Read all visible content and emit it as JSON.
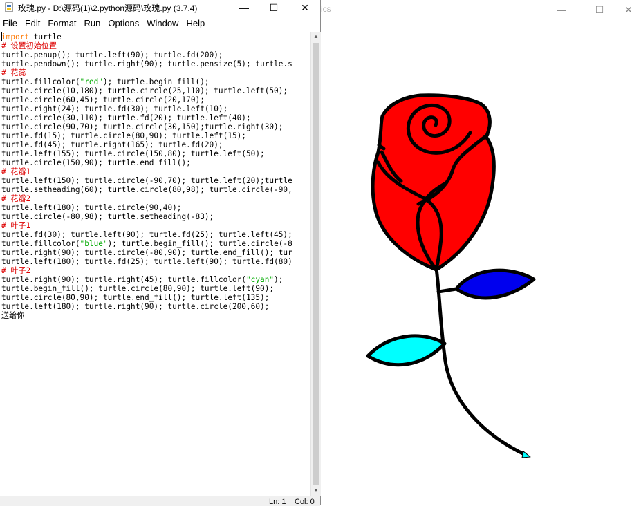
{
  "turtle_window": {
    "title": "ics",
    "controls": {
      "minimize": "—",
      "maximize": "☐",
      "close": "✕"
    },
    "colors": {
      "petal": "#ff0000",
      "leaf_upper": "#0000ee",
      "leaf_lower": "#00ffff",
      "stroke": "#000000",
      "turtle_cursor": "#00ffff"
    }
  },
  "editor": {
    "title": "玫瑰.py - D:\\源码(1)\\2.python源码\\玫瑰.py (3.7.4)",
    "controls": {
      "minimize": "—",
      "maximize": "☐",
      "close": "✕"
    },
    "menu": [
      "File",
      "Edit",
      "Format",
      "Run",
      "Options",
      "Window",
      "Help"
    ],
    "code_lines": [
      [
        {
          "t": "import",
          "c": "kw"
        },
        {
          "t": " turtle",
          "c": ""
        }
      ],
      [
        {
          "t": "# 设置初始位置",
          "c": "cm"
        }
      ],
      [
        {
          "t": "turtle.penup(); turtle.left(90); turtle.fd(200);",
          "c": ""
        }
      ],
      [
        {
          "t": "turtle.pendown(); turtle.right(90); turtle.pensize(5); turtle.s",
          "c": ""
        }
      ],
      [
        {
          "t": "# 花蕊",
          "c": "cm"
        }
      ],
      [
        {
          "t": "turtle.fillcolor(",
          "c": ""
        },
        {
          "t": "\"red\"",
          "c": "st"
        },
        {
          "t": "); turtle.begin_fill();",
          "c": ""
        }
      ],
      [
        {
          "t": "turtle.circle(10,180); turtle.circle(25,110); turtle.left(50);",
          "c": ""
        }
      ],
      [
        {
          "t": "turtle.circle(60,45); turtle.circle(20,170);",
          "c": ""
        }
      ],
      [
        {
          "t": "turtle.right(24); turtle.fd(30); turtle.left(10);",
          "c": ""
        }
      ],
      [
        {
          "t": "turtle.circle(30,110); turtle.fd(20); turtle.left(40);",
          "c": ""
        }
      ],
      [
        {
          "t": "turtle.circle(90,70); turtle.circle(30,150);turtle.right(30);",
          "c": ""
        }
      ],
      [
        {
          "t": "turtle.fd(15); turtle.circle(80,90); turtle.left(15);",
          "c": ""
        }
      ],
      [
        {
          "t": "turtle.fd(45); turtle.right(165); turtle.fd(20);",
          "c": ""
        }
      ],
      [
        {
          "t": "turtle.left(155); turtle.circle(150,80); turtle.left(50);",
          "c": ""
        }
      ],
      [
        {
          "t": "turtle.circle(150,90); turtle.end_fill();",
          "c": ""
        }
      ],
      [
        {
          "t": "# 花瓣1",
          "c": "cm"
        }
      ],
      [
        {
          "t": "turtle.left(150); turtle.circle(-90,70); turtle.left(20);turtle",
          "c": ""
        }
      ],
      [
        {
          "t": "turtle.setheading(60); turtle.circle(80,98); turtle.circle(-90,",
          "c": ""
        }
      ],
      [
        {
          "t": "# 花瓣2",
          "c": "cm"
        }
      ],
      [
        {
          "t": "turtle.left(180); turtle.circle(90,40);",
          "c": ""
        }
      ],
      [
        {
          "t": "turtle.circle(-80,98); turtle.setheading(-83);",
          "c": ""
        }
      ],
      [
        {
          "t": "# 叶子1",
          "c": "cm"
        }
      ],
      [
        {
          "t": "turtle.fd(30); turtle.left(90); turtle.fd(25); turtle.left(45);",
          "c": ""
        }
      ],
      [
        {
          "t": "turtle.fillcolor(",
          "c": ""
        },
        {
          "t": "\"blue\"",
          "c": "st"
        },
        {
          "t": "); turtle.begin_fill(); turtle.circle(-8",
          "c": ""
        }
      ],
      [
        {
          "t": "turtle.right(90); turtle.circle(-80,90); turtle.end_fill(); tur",
          "c": ""
        }
      ],
      [
        {
          "t": "turtle.left(180); turtle.fd(25); turtle.left(90); turtle.fd(80)",
          "c": ""
        }
      ],
      [
        {
          "t": "# 叶子2",
          "c": "cm"
        }
      ],
      [
        {
          "t": "turtle.right(90); turtle.right(45); turtle.fillcolor(",
          "c": ""
        },
        {
          "t": "\"cyan\"",
          "c": "st"
        },
        {
          "t": ");",
          "c": ""
        }
      ],
      [
        {
          "t": "turtle.begin_fill(); turtle.circle(80,90); turtle.left(90);",
          "c": ""
        }
      ],
      [
        {
          "t": "turtle.circle(80,90); turtle.end_fill(); turtle.left(135);",
          "c": ""
        }
      ],
      [
        {
          "t": "turtle.left(180); turtle.right(90); turtle.circle(200,60);",
          "c": ""
        }
      ],
      [
        {
          "t": "送给你",
          "c": ""
        }
      ]
    ],
    "status": {
      "ln": "Ln: 1",
      "col": "Col: 0"
    }
  }
}
